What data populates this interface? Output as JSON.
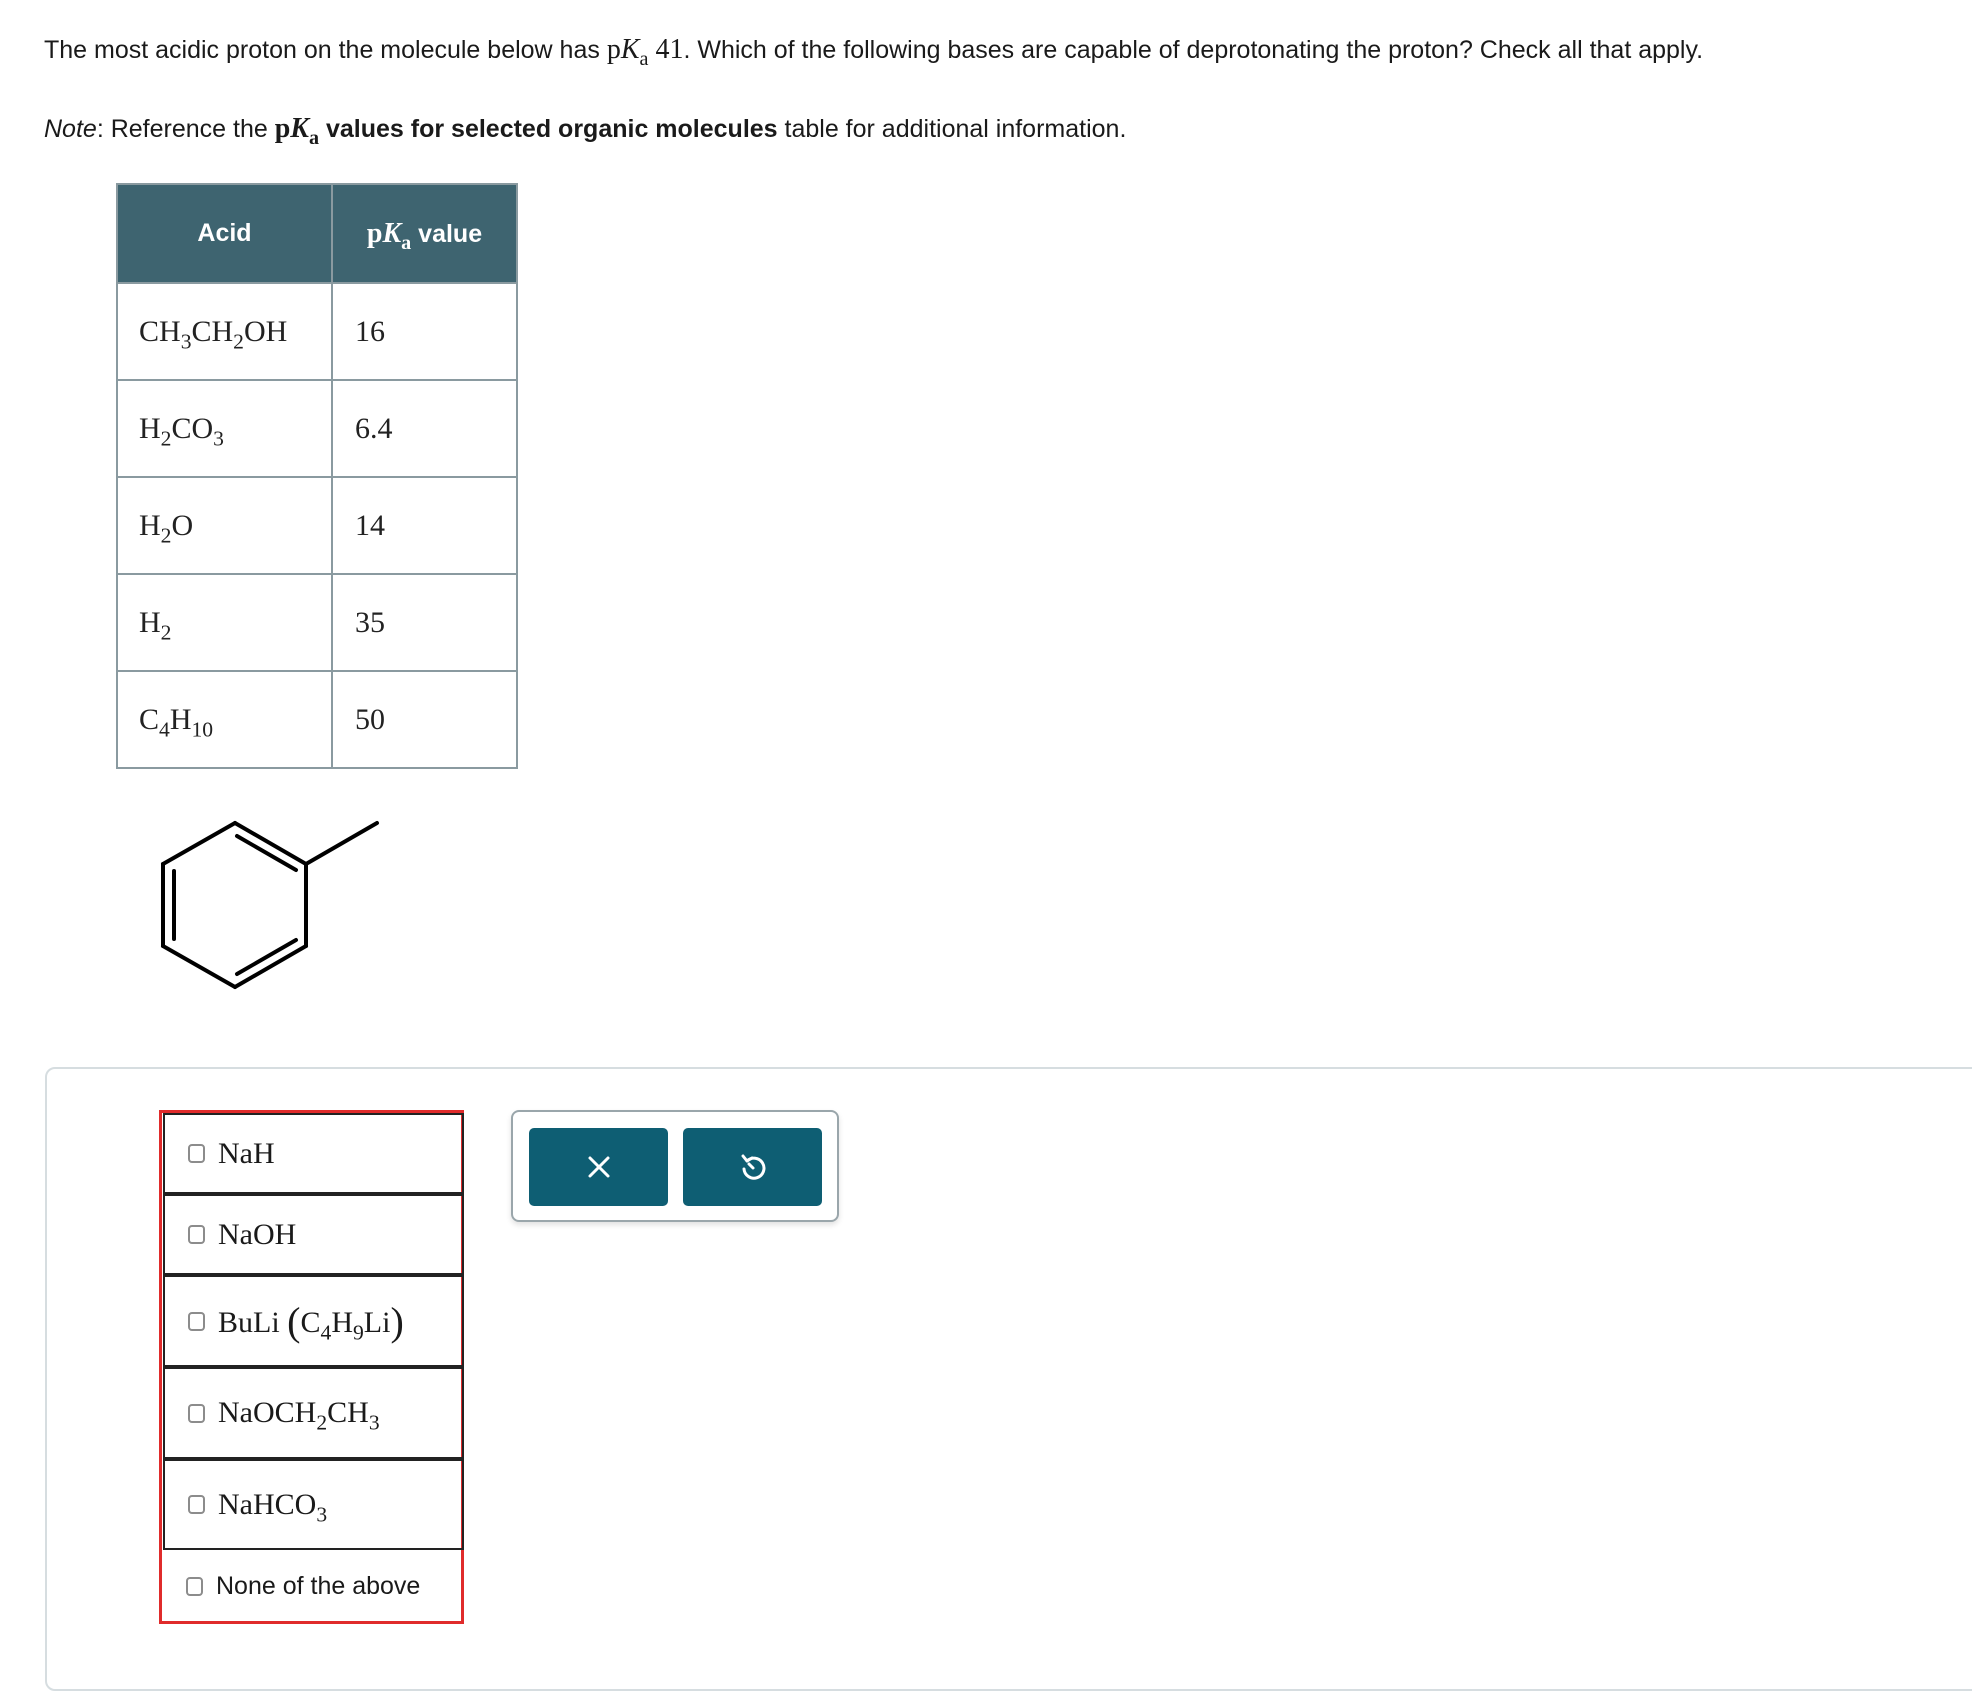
{
  "question": {
    "intro": "The most acidic proton on the molecule below has ",
    "pka_p": "p",
    "pka_K": "K",
    "pka_a": "a",
    "pka_value": "41",
    "rest": ". Which of the following bases are capable of deprotonating the proton? Check all that apply."
  },
  "note": {
    "label": "Note",
    "colon": ": Reference the ",
    "bold_rest": " values for selected organic molecules",
    "after": " table for additional information."
  },
  "table": {
    "header_acid": "Acid",
    "header_value": "value",
    "rows": [
      {
        "acid": {
          "parts": [
            "CH",
            "3",
            "CH",
            "2",
            "OH"
          ]
        },
        "value": "16"
      },
      {
        "acid": {
          "parts": [
            "H",
            "2",
            "CO",
            "3"
          ]
        },
        "value": "6.4"
      },
      {
        "acid": {
          "parts": [
            "H",
            "2",
            "O"
          ]
        },
        "value": "14"
      },
      {
        "acid": {
          "parts": [
            "H",
            "2"
          ]
        },
        "value": "35"
      },
      {
        "acid": {
          "parts": [
            "C",
            "4",
            "H",
            "10"
          ]
        },
        "value": "50"
      }
    ]
  },
  "choices": {
    "nah": "NaH",
    "naoh": "NaOH",
    "buli_name": "BuLi",
    "buli_formula": [
      "C",
      "4",
      "H",
      "9",
      "Li"
    ],
    "naoet": [
      "NaOCH",
      "2",
      "CH",
      "3"
    ],
    "nahco3": [
      "NaHCO",
      "3"
    ],
    "none": "None of the above"
  },
  "tools": {
    "clear_icon": "close-icon",
    "reset_icon": "undo-icon"
  }
}
